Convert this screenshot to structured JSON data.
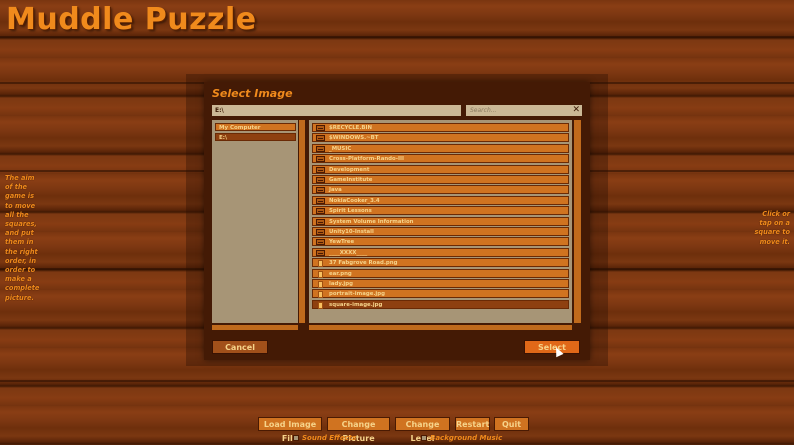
{
  "app": {
    "title": "Muddle Puzzle"
  },
  "instructions": {
    "left": "The aim of the game is to move all the squares, and put them in the right order, in order to make a complete picture.",
    "right": "Click or tap on a square to move it."
  },
  "dialog": {
    "title": "Select Image",
    "path": "E:\\",
    "search_placeholder": "Search...",
    "search_clear": "✕",
    "locations": [
      {
        "label": "My Computer",
        "selected": false
      },
      {
        "label": "E:\\",
        "selected": true
      }
    ],
    "files": [
      {
        "label": "$RECYCLE.BIN",
        "kind": "folder"
      },
      {
        "label": "$WINDOWS.~BT",
        "kind": "folder"
      },
      {
        "label": "_MUSIC",
        "kind": "folder"
      },
      {
        "label": "Cross-Platform-Rando-III",
        "kind": "folder"
      },
      {
        "label": "Development",
        "kind": "folder"
      },
      {
        "label": "GameInstitute",
        "kind": "folder"
      },
      {
        "label": "Java",
        "kind": "folder"
      },
      {
        "label": "NokiaCooker_3.4",
        "kind": "folder"
      },
      {
        "label": "Spirit Lessons",
        "kind": "folder"
      },
      {
        "label": "System Volume Information",
        "kind": "folder"
      },
      {
        "label": "Unity10-Install",
        "kind": "folder"
      },
      {
        "label": "YewTree",
        "kind": "folder"
      },
      {
        "label": "____XXXX____",
        "kind": "folder"
      },
      {
        "label": "37 Fabgrove Road.png",
        "kind": "file"
      },
      {
        "label": "ear.png",
        "kind": "file"
      },
      {
        "label": "lady.jpg",
        "kind": "file"
      },
      {
        "label": "portrait-image.jpg",
        "kind": "file"
      },
      {
        "label": "square-image.jpg",
        "kind": "file",
        "selected": true
      }
    ],
    "cancel_label": "Cancel",
    "select_label": "Select"
  },
  "toolbar": {
    "load_label": "Load Image File",
    "change_picture_label": "Change Picture",
    "change_level_label": "Change Level",
    "restart_label": "Restart",
    "quit_label": "Quit",
    "sound_effects_label": "Sound Effects",
    "background_music_label": "Background Music"
  }
}
